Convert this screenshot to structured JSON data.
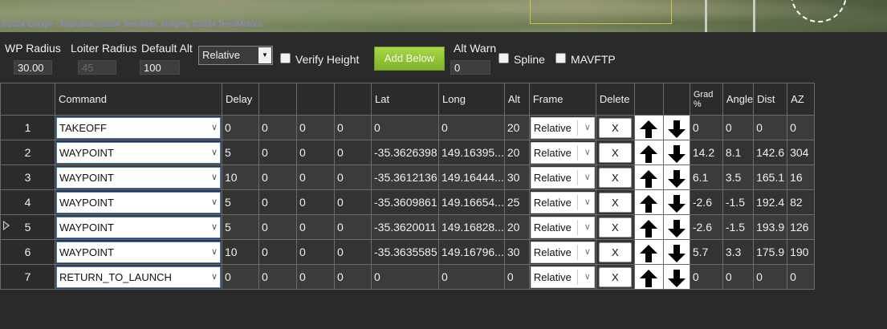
{
  "map": {
    "copyright": "©2024 Google - Map data ©2024 Tele Atlas, Imagery ©2024 TerraMetrics"
  },
  "toolbar": {
    "wp_radius_label": "WP Radius",
    "wp_radius_value": "30.00",
    "loiter_radius_label": "Loiter Radius",
    "loiter_radius_value": "45",
    "default_alt_label": "Default Alt",
    "default_alt_value": "100",
    "frame_select_value": "Relative",
    "verify_height_label": "Verify Height",
    "add_below_label": "Add Below",
    "alt_warn_label": "Alt Warn",
    "alt_warn_value": "0",
    "spline_label": "Spline",
    "mavftp_label": "MAVFTP"
  },
  "grid": {
    "headers": {
      "command": "Command",
      "delay": "Delay",
      "p2": "",
      "p3": "",
      "p4": "",
      "lat": "Lat",
      "long": "Long",
      "alt": "Alt",
      "frame": "Frame",
      "delete": "Delete",
      "up": "",
      "down": "",
      "grad": "Grad %",
      "angle": "Angle",
      "dist": "Dist",
      "az": "AZ"
    },
    "delete_label": "X",
    "selected_row": 5,
    "rows": [
      {
        "num": "1",
        "command": "TAKEOFF",
        "delay": "0",
        "p2": "0",
        "p3": "0",
        "p4": "0",
        "lat": "0",
        "long": "0",
        "alt": "20",
        "frame": "Relative",
        "grad": "0",
        "angle": "0",
        "dist": "0",
        "az": "0"
      },
      {
        "num": "2",
        "command": "WAYPOINT",
        "delay": "5",
        "p2": "0",
        "p3": "0",
        "p4": "0",
        "lat": "-35.3626398",
        "long": "149.16395...",
        "alt": "20",
        "frame": "Relative",
        "grad": "14.2",
        "angle": "8.1",
        "dist": "142.6",
        "az": "304"
      },
      {
        "num": "3",
        "command": "WAYPOINT",
        "delay": "10",
        "p2": "0",
        "p3": "0",
        "p4": "0",
        "lat": "-35.3612136",
        "long": "149.16444...",
        "alt": "30",
        "frame": "Relative",
        "grad": "6.1",
        "angle": "3.5",
        "dist": "165.1",
        "az": "16"
      },
      {
        "num": "4",
        "command": "WAYPOINT",
        "delay": "5",
        "p2": "0",
        "p3": "0",
        "p4": "0",
        "lat": "-35.3609861",
        "long": "149.16654...",
        "alt": "25",
        "frame": "Relative",
        "grad": "-2.6",
        "angle": "-1.5",
        "dist": "192.4",
        "az": "82"
      },
      {
        "num": "5",
        "command": "WAYPOINT",
        "delay": "5",
        "p2": "0",
        "p3": "0",
        "p4": "0",
        "lat": "-35.3620011",
        "long": "149.16828...",
        "alt": "20",
        "frame": "Relative",
        "grad": "-2.6",
        "angle": "-1.5",
        "dist": "193.9",
        "az": "126"
      },
      {
        "num": "6",
        "command": "WAYPOINT",
        "delay": "10",
        "p2": "0",
        "p3": "0",
        "p4": "0",
        "lat": "-35.3635585",
        "long": "149.16796...",
        "alt": "30",
        "frame": "Relative",
        "grad": "5.7",
        "angle": "3.3",
        "dist": "175.9",
        "az": "190"
      },
      {
        "num": "7",
        "command": "RETURN_TO_LAUNCH",
        "delay": "0",
        "p2": "0",
        "p3": "0",
        "p4": "0",
        "lat": "0",
        "long": "0",
        "alt": "0",
        "frame": "Relative",
        "grad": "0",
        "angle": "0",
        "dist": "0",
        "az": "0"
      }
    ]
  }
}
